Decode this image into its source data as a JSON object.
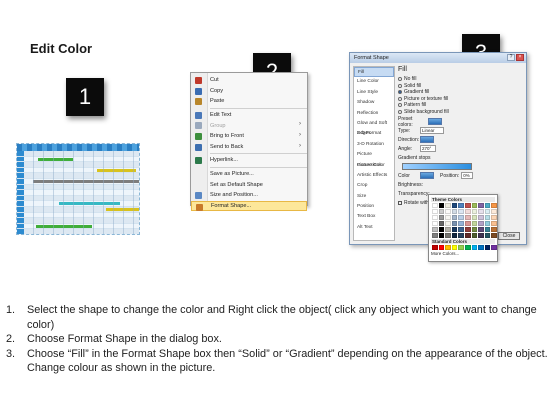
{
  "title": "Edit Color",
  "badges": {
    "one": "1",
    "two": "2",
    "three": "3"
  },
  "gantt": {
    "rows": 15,
    "bars": [
      {
        "row": 1,
        "start": 0.12,
        "end": 0.42,
        "color": "#3fae3a"
      },
      {
        "row": 3,
        "start": 0.62,
        "end": 0.96,
        "color": "#d8c21d"
      },
      {
        "row": 5,
        "start": 0.08,
        "end": 0.98,
        "color": "#7d7d7d"
      },
      {
        "row": 9,
        "start": 0.3,
        "end": 0.82,
        "color": "#35b9c4"
      },
      {
        "row": 10,
        "start": 0.7,
        "end": 0.98,
        "color": "#d8c21d"
      },
      {
        "row": 13,
        "start": 0.1,
        "end": 0.58,
        "color": "#3fae3a"
      }
    ]
  },
  "context_menu": {
    "items": [
      {
        "label": "Cut",
        "icon": "scissors-icon",
        "color": "#c0392b"
      },
      {
        "label": "Copy",
        "icon": "copy-icon",
        "color": "#3a6db3"
      },
      {
        "label": "Paste",
        "icon": "paste-icon",
        "color": "#b8862b"
      },
      {
        "label": "Edit Text",
        "icon": "edit-text-icon",
        "color": "#4a78b8"
      },
      {
        "label": "Group",
        "icon": "group-icon",
        "color": "#9aa9bd",
        "disabled": true,
        "submenu": true
      },
      {
        "label": "Bring to Front",
        "icon": "bring-front-icon",
        "color": "#3d8f3d",
        "submenu": true
      },
      {
        "label": "Send to Back",
        "icon": "send-back-icon",
        "color": "#3d6fb0",
        "submenu": true
      },
      {
        "label": "Hyperlink...",
        "icon": "hyperlink-icon",
        "color": "#2c7a4b"
      },
      {
        "label": "Save as Picture...",
        "icon": "",
        "color": ""
      },
      {
        "label": "Set as Default Shape",
        "icon": "",
        "color": ""
      },
      {
        "label": "Size and Position...",
        "icon": "size-icon",
        "color": "#5a88c4"
      },
      {
        "label": "Format Shape...",
        "icon": "format-shape-icon",
        "color": "#c87a2a",
        "selected": true
      }
    ]
  },
  "dialog": {
    "title": "Format Shape",
    "nav": [
      "Fill",
      "Line Color",
      "Line Style",
      "Shadow",
      "Reflection",
      "Glow and Soft Edges",
      "3-D Format",
      "3-D Rotation",
      "Picture Corrections",
      "Picture Color",
      "Artistic Effects",
      "Crop",
      "Size",
      "Position",
      "Text Box",
      "Alt Text"
    ],
    "pane_title": "Fill",
    "fill_options": [
      "No fill",
      "Solid fill",
      "Gradient fill",
      "Picture or texture fill",
      "Pattern fill",
      "Slide background fill"
    ],
    "selected_fill_index": 2,
    "fields": {
      "preset": "Preset colors:",
      "type_label": "Type:",
      "type_value": "Linear",
      "direction": "Direction:",
      "angle_label": "Angle:",
      "angle_value": "270°",
      "stops_label": "Gradient stops",
      "color_label": "Color",
      "position_label": "Position:",
      "position_value": "0%",
      "brightness_label": "Brightness:",
      "transparency_label": "Transparency:",
      "rotate_label": "Rotate with shape"
    },
    "close_label": "Close"
  },
  "color_popup": {
    "theme_label": "Theme Colors",
    "standard_label": "Standard Colors",
    "more_label": "More Colors...",
    "theme_top": [
      "#ffffff",
      "#000000",
      "#eeece1",
      "#1f497d",
      "#4f81bd",
      "#c0504d",
      "#9bbb59",
      "#8064a2",
      "#4bacc6",
      "#f79646"
    ],
    "standard": [
      "#c00000",
      "#ff0000",
      "#ffc000",
      "#ffff00",
      "#92d050",
      "#00b050",
      "#00b0f0",
      "#0070c0",
      "#002060",
      "#7030a0"
    ]
  },
  "steps": [
    {
      "num": "1.",
      "text": "Select the shape to change the color and Right click the object( click any object which you want to change color)"
    },
    {
      "num": "2.",
      "text": "Choose Format Shape in the dialog box."
    },
    {
      "num": "3.",
      "text": "Choose “Fill” in the Format Shape box then “Solid” or “Gradient” depending on the appearance of the object. Change colour as shown in the picture."
    }
  ]
}
